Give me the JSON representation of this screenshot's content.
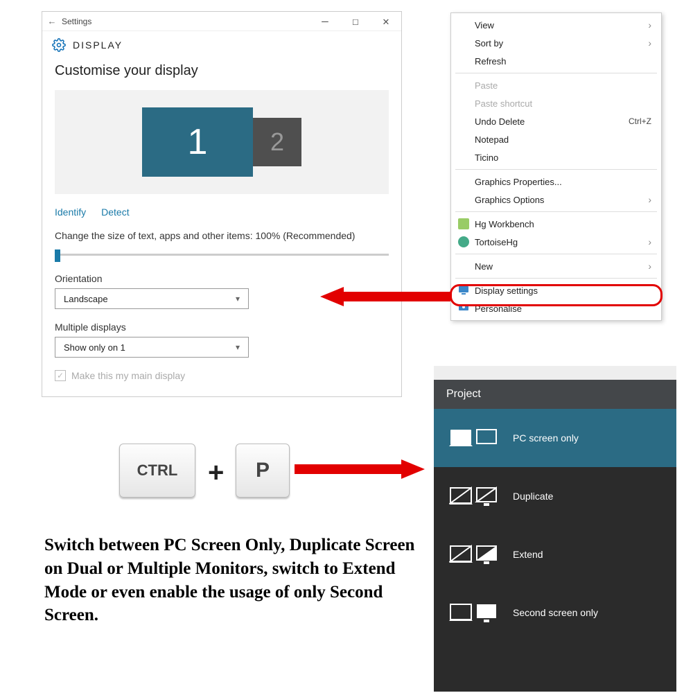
{
  "settings": {
    "titlebar_label": "Settings",
    "header": "DISPLAY",
    "heading": "Customise your display",
    "monitor1": "1",
    "monitor2": "2",
    "identify": "Identify",
    "detect": "Detect",
    "scale_text": "Change the size of text, apps and other items: 100% (Recommended)",
    "orientation_label": "Orientation",
    "orientation_value": "Landscape",
    "multidisplay_label": "Multiple displays",
    "multidisplay_value": "Show only on 1",
    "main_display_label": "Make this my main display"
  },
  "ctx": {
    "view": "View",
    "sortby": "Sort by",
    "refresh": "Refresh",
    "paste": "Paste",
    "paste_shortcut": "Paste shortcut",
    "undo": "Undo Delete",
    "undo_kbd": "Ctrl+Z",
    "notepad": "Notepad",
    "ticino": "Ticino",
    "gfx_props": "Graphics Properties...",
    "gfx_opts": "Graphics Options",
    "hg": "Hg Workbench",
    "tortoise": "TortoiseHg",
    "new": "New",
    "display": "Display settings",
    "personalise": "Personalise"
  },
  "keys": {
    "ctrl": "CTRL",
    "plus": "+",
    "p": "P"
  },
  "caption": "Switch between PC Screen Only, Duplicate Screen on Dual or Multiple Monitors, switch to Extend Mode or even enable the usage of only Second Screen.",
  "project": {
    "title": "Project",
    "pc_only": "PC screen only",
    "duplicate": "Duplicate",
    "extend": "Extend",
    "second_only": "Second screen only"
  }
}
